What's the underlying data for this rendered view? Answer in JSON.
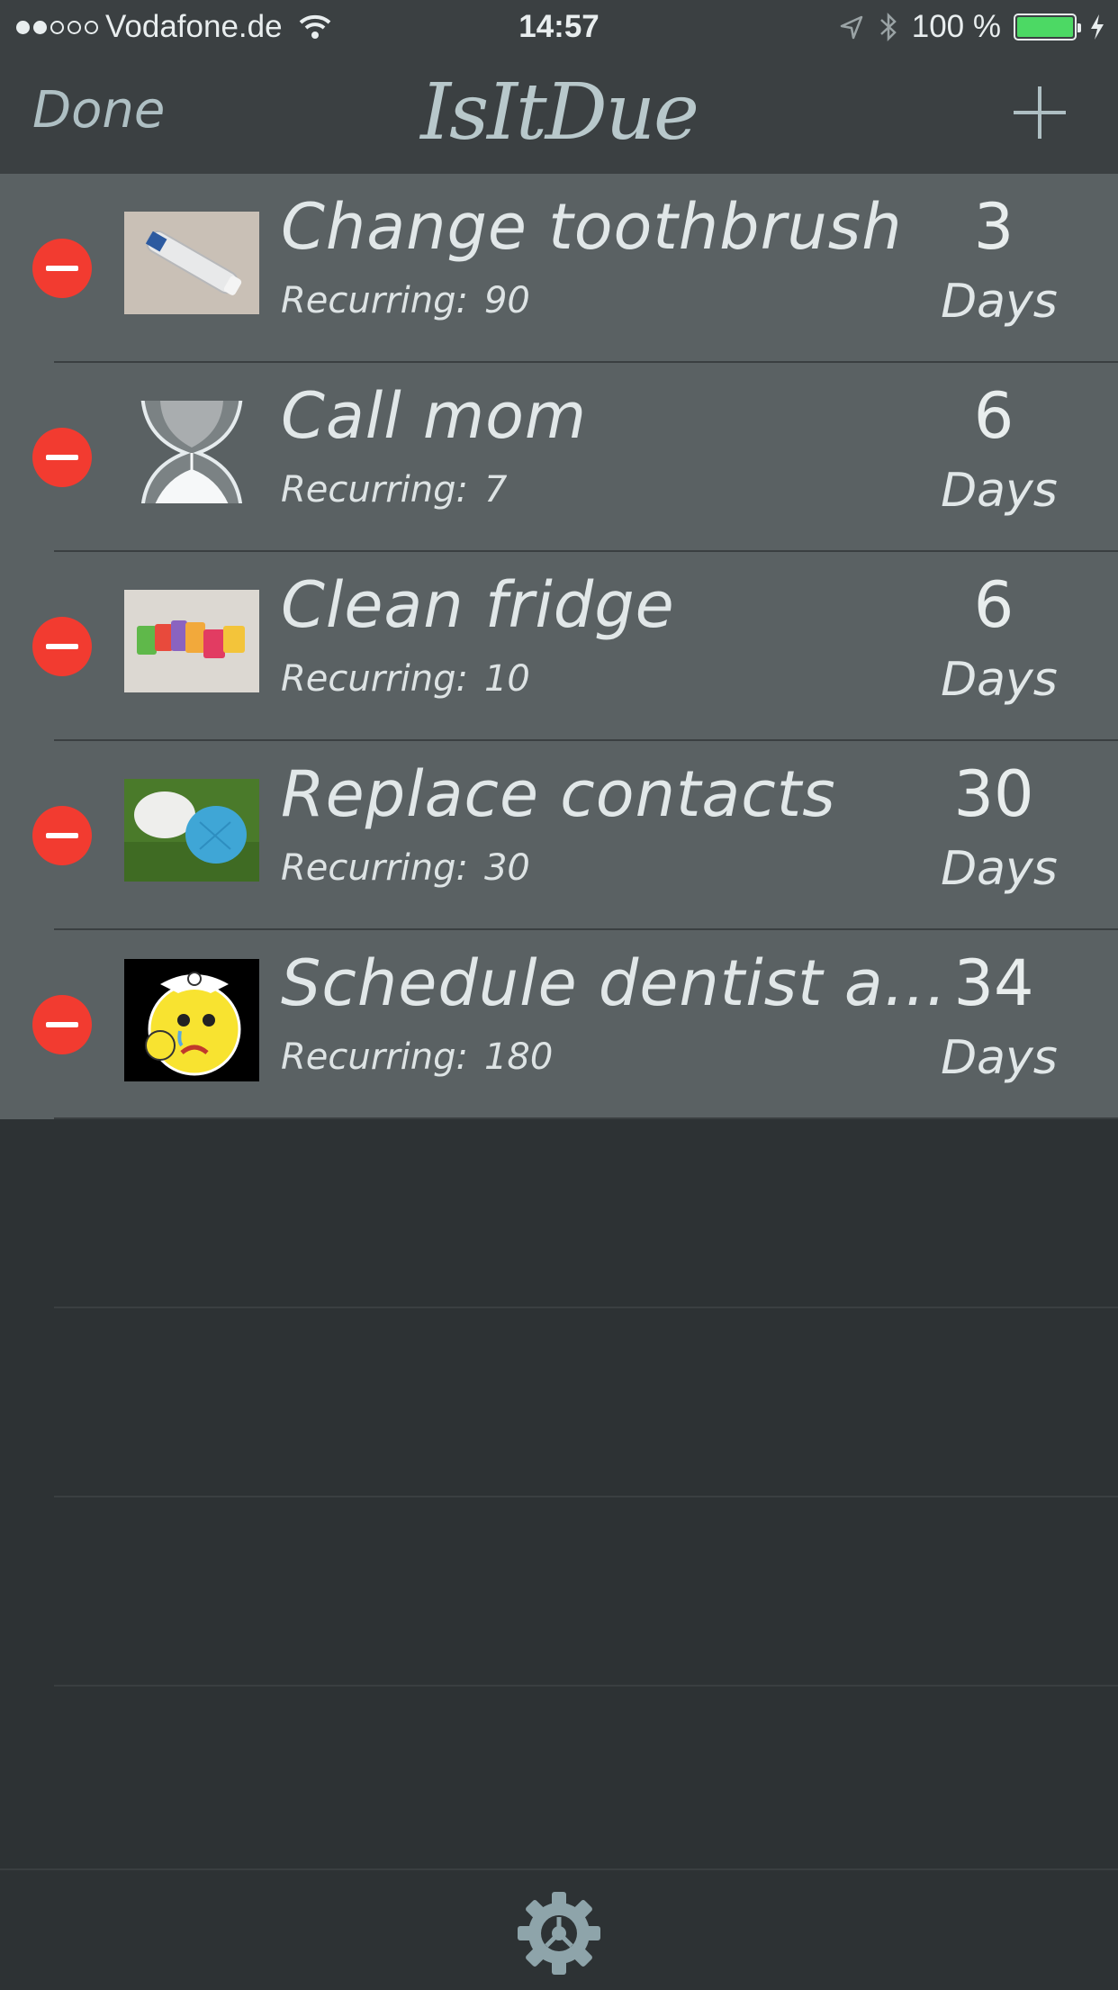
{
  "status_bar": {
    "carrier": "Vodafone.de",
    "time": "14:57",
    "battery": "100 %",
    "signal_filled": 2,
    "signal_total": 5,
    "battery_color": "#4cd964"
  },
  "nav": {
    "done_label": "Done",
    "title": "IsItDue",
    "add_icon": "plus-icon"
  },
  "tasks": [
    {
      "title": "Change toothbrush",
      "recurring_label": "Recurring:",
      "recurring": "90",
      "days": "3",
      "days_label": "Days",
      "thumb": "toothbrush-photo"
    },
    {
      "title": "Call mom",
      "recurring_label": "Recurring:",
      "recurring": "7",
      "days": "6",
      "days_label": "Days",
      "thumb": "hourglass-icon"
    },
    {
      "title": "Clean fridge",
      "recurring_label": "Recurring:",
      "recurring": "10",
      "days": "6",
      "days_label": "Days",
      "thumb": "fridge-letters-photo"
    },
    {
      "title": "Replace contacts",
      "recurring_label": "Recurring:",
      "recurring": "30",
      "days": "30",
      "days_label": "Days",
      "thumb": "contact-case-photo"
    },
    {
      "title": "Schedule dentist appointment",
      "recurring_label": "Recurring:",
      "recurring": "180",
      "days": "34",
      "days_label": "Days",
      "thumb": "toothache-emoji"
    }
  ],
  "bottom_bar": {
    "settings_icon": "gear-icon"
  },
  "colors": {
    "background": "#2d3234",
    "bar": "#3b4042",
    "row": "#5a6163",
    "delete": "#f23b30",
    "accent": "#aebfc3"
  }
}
